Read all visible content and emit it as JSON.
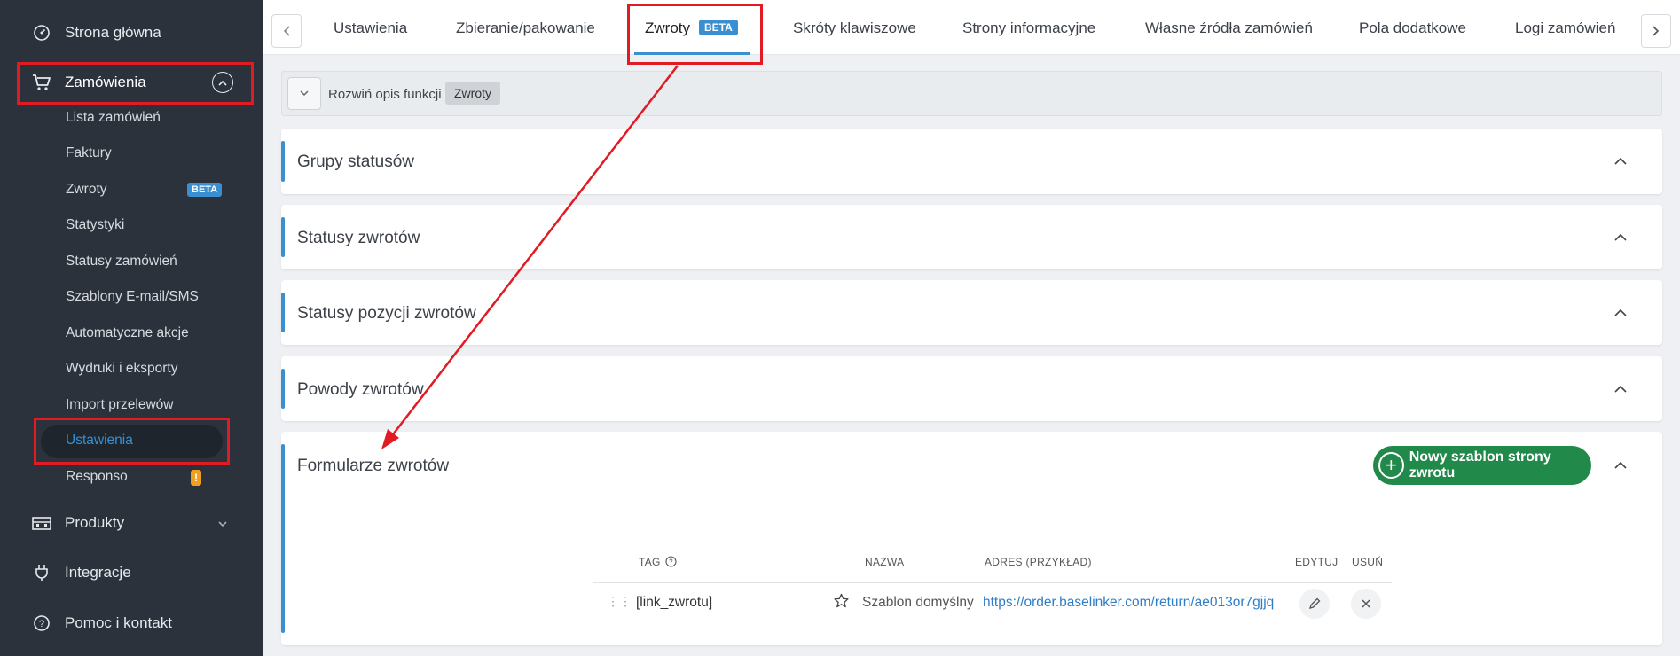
{
  "sidebar": {
    "home": "Strona główna",
    "orders": "Zamówienia",
    "sub_items": [
      "Lista zamówień",
      "Faktury",
      "Zwroty",
      "Statystyki",
      "Statusy zamówień",
      "Szablony E-mail/SMS",
      "Automatyczne akcje",
      "Wydruki i eksporty",
      "Import przelewów",
      "Ustawienia",
      "Responso"
    ],
    "beta": "BETA",
    "warn": "!",
    "products": "Produkty",
    "integrations": "Integracje",
    "help": "Pomoc i kontakt"
  },
  "tabs": {
    "items": [
      "Ustawienia",
      "Zbieranie/pakowanie",
      "Zwroty",
      "Skróty klawiszowe",
      "Strony informacyjne",
      "Własne źródła zamówień",
      "Pola dodatkowe",
      "Logi zamówień"
    ],
    "beta": "BETA"
  },
  "description": {
    "text": "Rozwiń opis funkcji",
    "tag": "Zwroty"
  },
  "panels": [
    "Grupy statusów",
    "Statusy zwrotów",
    "Statusy pozycji zwrotów",
    "Powody zwrotów",
    "Formularze zwrotów"
  ],
  "new_template_button": "Nowy szablon strony zwrotu",
  "table": {
    "headers": [
      "TAG",
      "NAZWA",
      "ADRES (PRZYKŁAD)",
      "EDYTUJ",
      "USUŃ"
    ],
    "row": {
      "tag": "[link_zwrotu]",
      "name": "Szablon domyślny",
      "address": "https://order.baselinker.com/return/ae013or7gjjq"
    }
  },
  "colors": {
    "sidebar_bg": "#2b323b",
    "accent": "#3a8fd1",
    "success": "#218a4b",
    "annotation": "#e01b24"
  }
}
